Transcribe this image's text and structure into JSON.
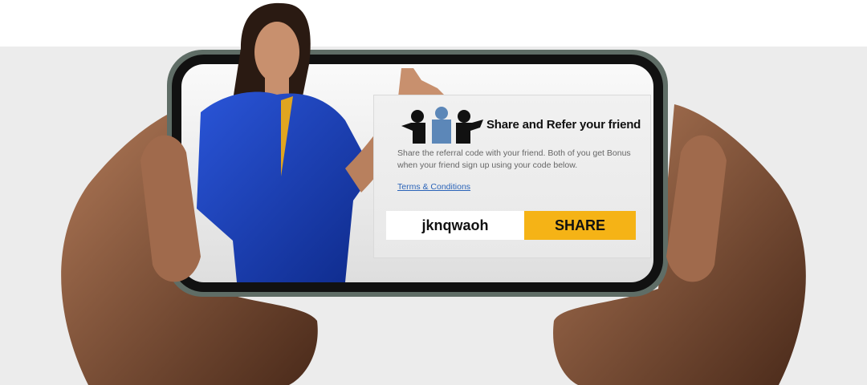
{
  "card": {
    "title": "Share and Refer your friend",
    "description": "Share the referral code with your friend. Both of you get Bonus when your friend sign up using your code below.",
    "terms_link": "Terms & Conditions",
    "referral_code": "jknqwaoh",
    "share_label": "SHARE",
    "icon": "people-share-icon"
  },
  "colors": {
    "accent": "#f5b316",
    "link": "#2a63b8",
    "dress": "#1a3fb0"
  }
}
